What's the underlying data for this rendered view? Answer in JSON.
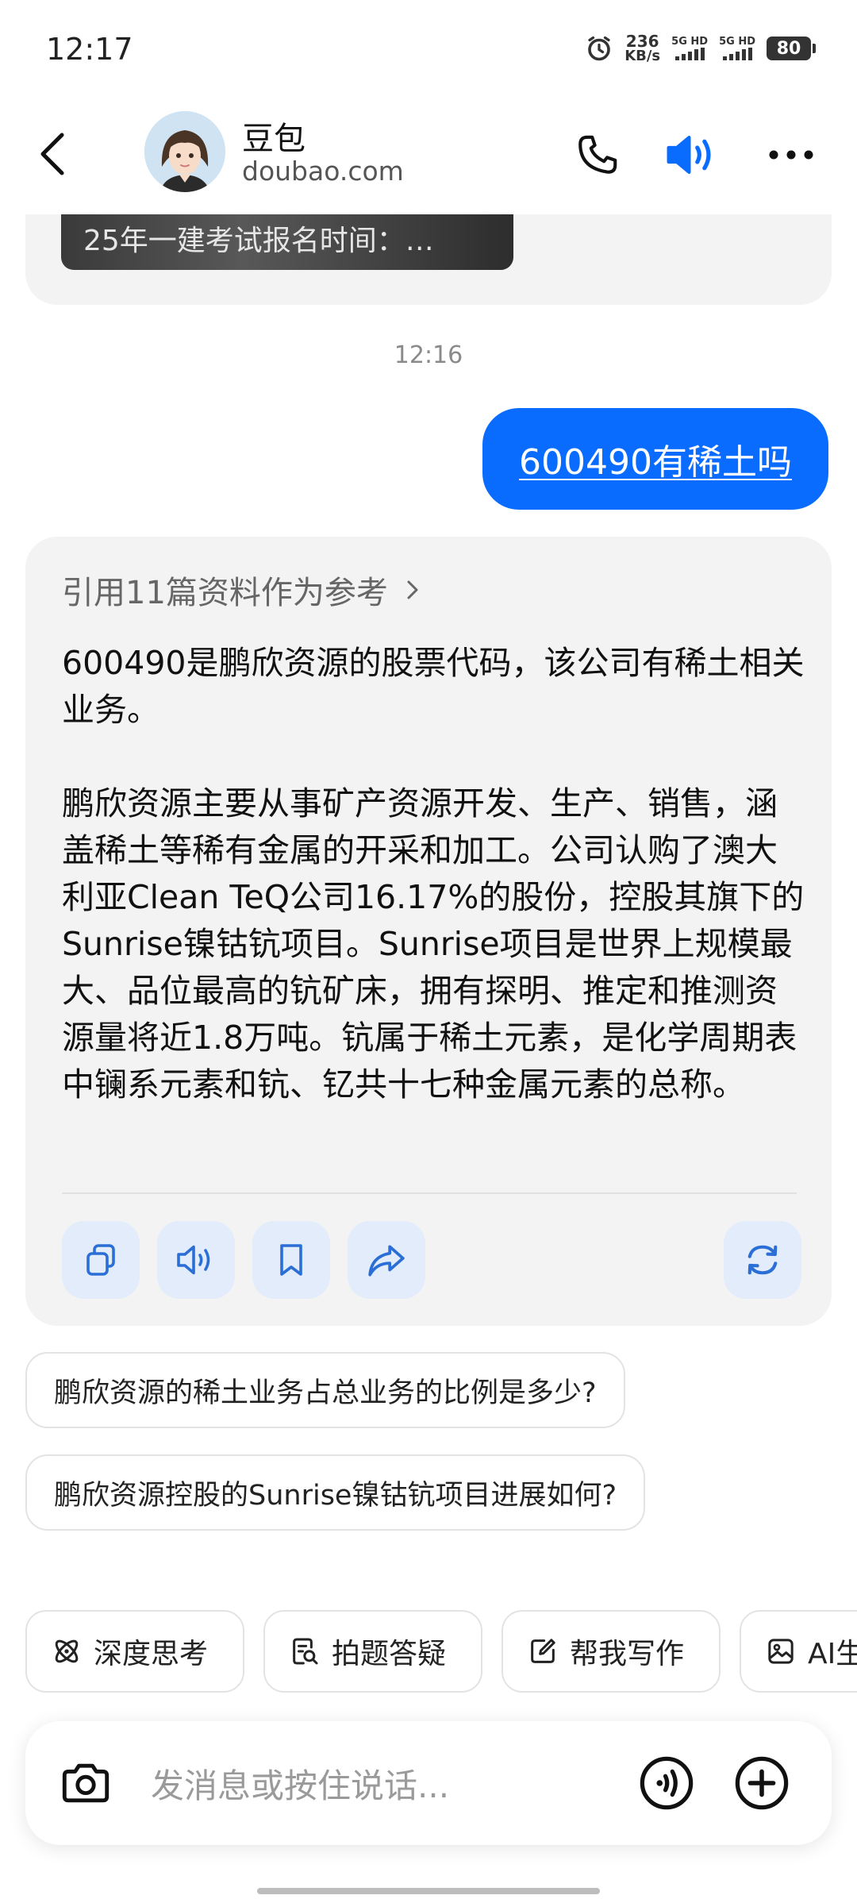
{
  "status": {
    "time": "12:17",
    "speed_value": "236",
    "speed_unit": "KB/s",
    "sim1": "5G HD",
    "sim2": "5G HD",
    "battery": "80"
  },
  "header": {
    "name": "豆包",
    "domain": "doubao.com"
  },
  "prev_card": {
    "image_caption": "25年一建考试报名时间：…"
  },
  "timestamp": "12:16",
  "user_message": "600490有稀土吗",
  "answer": {
    "reference": "引用11篇资料作为参考",
    "paragraph1": "600490是鹏欣资源的股票代码，该公司有稀土相关业务。",
    "paragraph2": "鹏欣资源主要从事矿产资源开发、生产、销售，涵盖稀土等稀有金属的开采和加工。公司认购了澳大利亚Clean TeQ公司16.17%的股份，控股其旗下的Sunrise镍钴钪项目。Sunrise项目是世界上规模最大、品位最高的钪矿床，拥有探明、推定和推测资源量将近1.8万吨。钪属于稀土元素，是化学周期表中镧系元素和钪、钇共十七种金属元素的总称。"
  },
  "suggestions": [
    "鹏欣资源的稀土业务占总业务的比例是多少?",
    "鹏欣资源控股的Sunrise镍钴钪项目进展如何?"
  ],
  "chips": [
    {
      "label": "深度思考",
      "icon": "deep-think-icon"
    },
    {
      "label": "拍题答疑",
      "icon": "photo-question-icon"
    },
    {
      "label": "帮我写作",
      "icon": "write-icon"
    },
    {
      "label": "AI生",
      "icon": "image-icon"
    }
  ],
  "input": {
    "placeholder": "发消息或按住说话..."
  },
  "colors": {
    "accent": "#0a6cff",
    "card_bg": "#f3f3f4",
    "action_btn_bg": "#e2ecfb"
  }
}
